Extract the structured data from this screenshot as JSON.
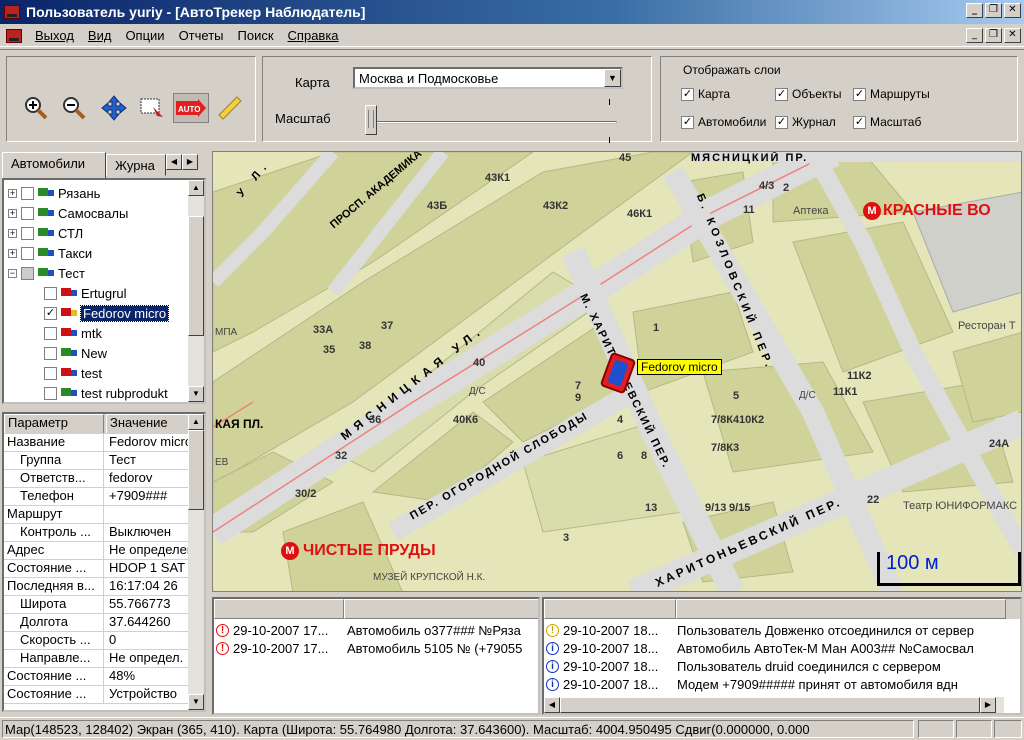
{
  "window": {
    "title": "Пользователь  yuriy   - [АвтоТрекер Наблюдатель]",
    "minimize": "_",
    "restore": "❐",
    "close": "✕"
  },
  "menu": [
    {
      "label": "Выход"
    },
    {
      "label": "Вид"
    },
    {
      "label": "Опции"
    },
    {
      "label": "Отчеты"
    },
    {
      "label": "Поиск"
    },
    {
      "label": "Справка"
    }
  ],
  "toolbar": {
    "tools": [
      {
        "icon": "zoom-in-icon"
      },
      {
        "icon": "zoom-out-icon"
      },
      {
        "icon": "pan-icon"
      },
      {
        "icon": "zoom-rect-icon"
      },
      {
        "icon": "auto-icon",
        "label": "AUTO"
      },
      {
        "icon": "ruler-icon"
      }
    ],
    "map_label": "Карта",
    "map_value": "Москва и Подмосковье",
    "scale_label": "Масштаб",
    "layers_title": "Отображать слои",
    "layers": [
      {
        "label": "Карта",
        "checked": true
      },
      {
        "label": "Объекты",
        "checked": true
      },
      {
        "label": "Маршруты",
        "checked": true
      },
      {
        "label": "Автомобили",
        "checked": true
      },
      {
        "label": "Журнал",
        "checked": true
      },
      {
        "label": "Масштаб",
        "checked": true
      }
    ]
  },
  "left": {
    "tabs": [
      "Автомобили",
      "Журна"
    ],
    "tree": [
      {
        "label": "Рязань",
        "level": 0,
        "exp": "+",
        "color": "#2a8a2a"
      },
      {
        "label": "Самосвалы",
        "level": 0,
        "exp": "+",
        "color": "#2a8a2a"
      },
      {
        "label": "СТЛ",
        "level": 0,
        "exp": "+",
        "color": "#2a8a2a"
      },
      {
        "label": "Такси",
        "level": 0,
        "exp": "+",
        "color": "#2a8a2a"
      },
      {
        "label": "Тест",
        "level": 0,
        "exp": "−",
        "color": "#2a8a2a"
      },
      {
        "label": "Ertugrul",
        "level": 1,
        "color": "#d01010"
      },
      {
        "label": "Fedorov micro",
        "level": 1,
        "color": "#d01010",
        "checked": true,
        "selected": true
      },
      {
        "label": "mtk",
        "level": 1,
        "color": "#d01010"
      },
      {
        "label": "New",
        "level": 1,
        "color": "#2a8a2a"
      },
      {
        "label": "test",
        "level": 1,
        "color": "#d01010"
      },
      {
        "label": "test rubprodukt",
        "level": 1,
        "color": "#2a8a2a"
      }
    ],
    "props_header": {
      "k": "Параметр",
      "v": "Значение"
    },
    "props": [
      {
        "k": "Название",
        "v": "Fedorov micro",
        "indent": 0
      },
      {
        "k": "Группа",
        "v": "Тест",
        "indent": 1
      },
      {
        "k": "Ответств...",
        "v": "fedorov",
        "indent": 1
      },
      {
        "k": "Телефон",
        "v": "+7909###",
        "indent": 1
      },
      {
        "k": "Маршрут",
        "v": "",
        "indent": 0
      },
      {
        "k": "Контроль ...",
        "v": "Выключен",
        "indent": 1
      },
      {
        "k": "Адрес",
        "v": "Не определен",
        "indent": 0
      },
      {
        "k": "Состояние ...",
        "v": "HDOP 1 SAT",
        "indent": 0
      },
      {
        "k": "Последняя в...",
        "v": "16:17:04 26",
        "indent": 0
      },
      {
        "k": "Широта",
        "v": "55.766773",
        "indent": 1
      },
      {
        "k": "Долгота",
        "v": "37.644260",
        "indent": 1
      },
      {
        "k": "Скорость ...",
        "v": "0",
        "indent": 1
      },
      {
        "k": "Направле...",
        "v": "Не определ.",
        "indent": 1
      },
      {
        "k": "Состояние ...",
        "v": "48%",
        "indent": 0
      },
      {
        "k": "Состояние ...",
        "v": "Устройство",
        "indent": 0
      }
    ]
  },
  "map": {
    "streets": [
      {
        "text": "МЯСНИЦКИЙ ПР."
      },
      {
        "text": "ПРОСП. АКАДЕМИКА"
      },
      {
        "text": "Б. КОЗЛОВСКИЙ ПЕР."
      },
      {
        "text": "МЯСНИЦКАЯ УЛ."
      },
      {
        "text": "М. ХАРИТОНЬЕВСКИЙ ПЕР."
      },
      {
        "text": "ПЕР. ОГОРОДНОЙ СЛОБОДЫ"
      },
      {
        "text": "ХАРИТОНЬЕВСКИЙ ПЕР."
      },
      {
        "text": "У Л."
      }
    ],
    "metro": [
      {
        "text": "КРАСНЫЕ ВО"
      },
      {
        "text": "ЧИСТЫЕ ПРУДЫ"
      }
    ],
    "pois": [
      {
        "text": "Аптека"
      },
      {
        "text": "Ресторан Т"
      },
      {
        "text": "Театр ЮНИФОРМАКС"
      },
      {
        "text": "МУЗЕЙ КРУПСКОЙ Н.К."
      },
      {
        "text": "Д/С"
      },
      {
        "text": "Д/С"
      },
      {
        "text": "МПА"
      },
      {
        "text": "КАЯ ПЛ."
      },
      {
        "text": "ЕВ"
      }
    ],
    "numbers": [
      "45",
      "43К1",
      "43К2",
      "43Б",
      "46К1",
      "4/3",
      "11",
      "33А",
      "37",
      "38",
      "35",
      "40",
      "40К6",
      "36",
      "32",
      "30/2",
      "7/8К4",
      "10К2",
      "7/8К3",
      "9/13",
      "9/15",
      "11К2",
      "11К1",
      "24А",
      "22",
      "5",
      "7",
      "9",
      "4",
      "6",
      "8",
      "13",
      "3",
      "1",
      "2"
    ],
    "vehicle": {
      "label": "Fedorov micro"
    },
    "scale": "100 м"
  },
  "logs": {
    "left": [
      {
        "icon": "error",
        "date": "29-10-2007 17...",
        "text": "Автомобиль о377### №Ряза"
      },
      {
        "icon": "error",
        "date": "29-10-2007 17...",
        "text": "Автомобиль 5105 № (+79055"
      }
    ],
    "right": [
      {
        "icon": "warning",
        "date": "29-10-2007 18...",
        "text": "Пользователь Довженко отсоединился от сервер"
      },
      {
        "icon": "info",
        "date": "29-10-2007 18...",
        "text": "Автомобиль АвтоТек-М Ман А003## №Самосвал"
      },
      {
        "icon": "info",
        "date": "29-10-2007 18...",
        "text": "Пользователь druid соединился с сервером"
      },
      {
        "icon": "info",
        "date": "29-10-2007 18...",
        "text": "Модем +7909#####  принят от автомобиля вдн"
      }
    ]
  },
  "status": "Мар(148523, 128402) Экран (365, 410). Карта (Широта: 55.764980  Долгота: 37.643600). Масштаб: 4004.950495 Сдвиг(0.000000, 0.000"
}
